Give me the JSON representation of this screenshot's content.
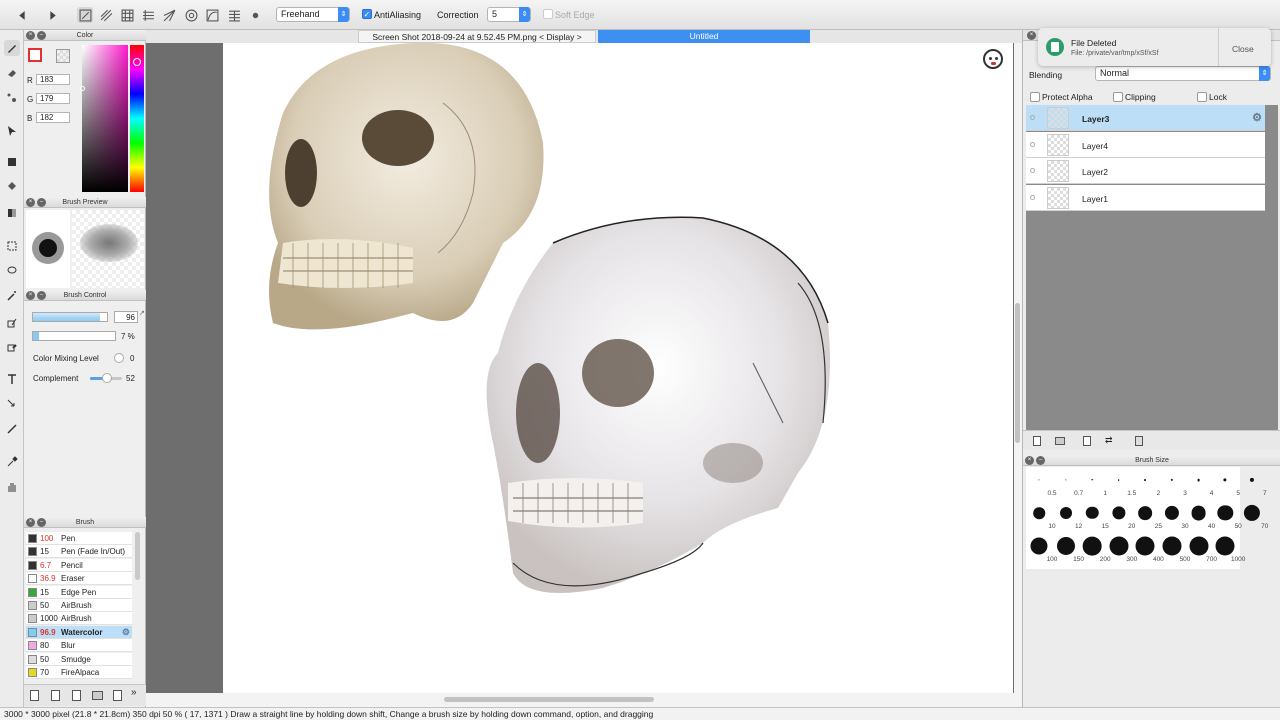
{
  "toolbar": {
    "mode_value": "Freehand",
    "antialiasing_label": "AntiAliasing",
    "antialiasing_checked": true,
    "correction_label": "Correction",
    "correction_value": "5",
    "soft_edge_label": "Soft Edge"
  },
  "color_panel": {
    "title": "Color",
    "r_label": "R",
    "r_value": "183",
    "g_label": "G",
    "g_value": "179",
    "b_label": "B",
    "b_value": "182"
  },
  "brush_preview": {
    "title": "Brush Preview"
  },
  "brush_control": {
    "title": "Brush Control",
    "size_value": "96",
    "opacity_value": "7 %",
    "color_mixing_label": "Color Mixing Level",
    "color_mixing_value": "0",
    "complement_label": "Complement",
    "complement_value": "52"
  },
  "brush_panel": {
    "title": "Brush",
    "items": [
      {
        "size": "100",
        "name": "Pen",
        "swatch": "#333333",
        "red": true
      },
      {
        "size": "15",
        "name": "Pen (Fade In/Out)",
        "swatch": "#333333",
        "red": false
      },
      {
        "size": "6.7",
        "name": "Pencil",
        "swatch": "#333333",
        "red": true
      },
      {
        "size": "36.9",
        "name": "Eraser",
        "swatch": "#ffffff",
        "red": true
      },
      {
        "size": "15",
        "name": "Edge Pen",
        "swatch": "#33aa33",
        "red": false
      },
      {
        "size": "50",
        "name": "AirBrush",
        "swatch": "#cccccc",
        "red": false
      },
      {
        "size": "1000",
        "name": "AirBrush",
        "swatch": "#cccccc",
        "red": false
      },
      {
        "size": "96.9",
        "name": "Watercolor",
        "swatch": "#7fd0f0",
        "red": true
      },
      {
        "size": "80",
        "name": "Blur",
        "swatch": "#f0a8e8",
        "red": false
      },
      {
        "size": "50",
        "name": "Smudge",
        "swatch": "#dddddd",
        "red": false
      },
      {
        "size": "70",
        "name": "FireAlpaca",
        "swatch": "#e8d820",
        "red": false
      }
    ]
  },
  "document_tabs": [
    {
      "label": "Screen Shot 2018-09-24 at 9.52.45 PM.png < Display >",
      "active": false
    },
    {
      "label": "Untitled",
      "active": true
    }
  ],
  "layer_panel": {
    "blending_label": "Blending",
    "blending_value": "Normal",
    "protect_alpha_label": "Protect Alpha",
    "clipping_label": "Clipping",
    "lock_label": "Lock",
    "layers": [
      {
        "name": "Layer3",
        "selected": true
      },
      {
        "name": "Layer4",
        "selected": false
      },
      {
        "name": "Layer2",
        "selected": false
      },
      {
        "name": "Layer1",
        "selected": false
      }
    ]
  },
  "brush_size_panel": {
    "title": "Brush Size",
    "sizes": [
      "0.5",
      "0.7",
      "1",
      "1.5",
      "2",
      "3",
      "4",
      "5",
      "7",
      "10",
      "12",
      "15",
      "20",
      "25",
      "30",
      "40",
      "50",
      "70",
      "100",
      "150",
      "200",
      "300",
      "400",
      "500",
      "700",
      "1000"
    ]
  },
  "notification": {
    "title": "File Deleted",
    "body": "File: /private/var/tmp/xSf/xSf",
    "close_label": "Close"
  },
  "status_bar": {
    "text": "3000 * 3000 pixel  (21.8 * 21.8cm)  350 dpi  50 %  ( 17, 1371 )  Draw a straight line by holding down shift, Change a brush size by holding down command, option, and dragging"
  }
}
